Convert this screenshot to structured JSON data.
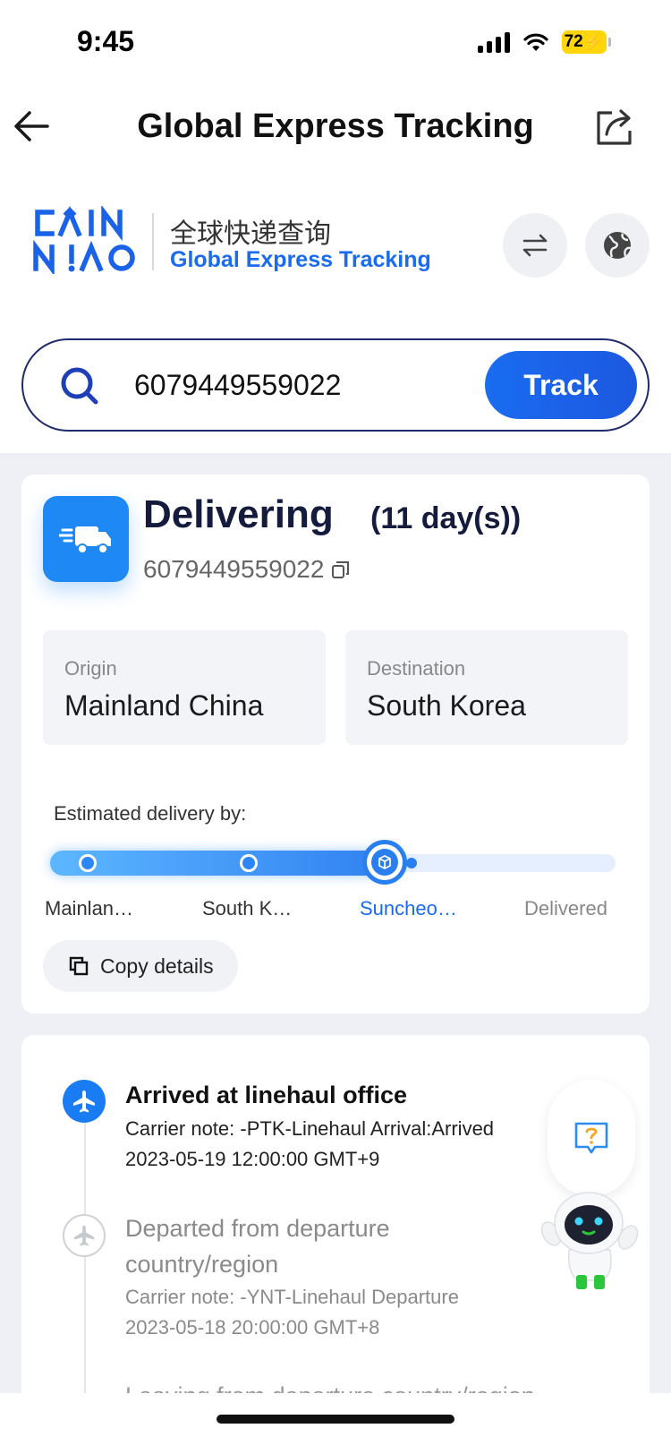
{
  "status_bar": {
    "time": "9:45",
    "battery": "72"
  },
  "header": {
    "title": "Global Express Tracking"
  },
  "brand": {
    "cn_title": "全球快递查询",
    "en_title": "Global Express Tracking"
  },
  "search": {
    "value": "6079449559022",
    "button_label": "Track"
  },
  "summary": {
    "status": "Delivering",
    "days": "(11 day(s))",
    "tracking_number": "6079449559022",
    "origin_label": "Origin",
    "origin_value": "Mainland China",
    "destination_label": "Destination",
    "destination_value": "South Korea",
    "estimate_label": "Estimated delivery by:",
    "progress_fraction": 0.62,
    "stages": [
      "Mainlan…",
      "South K…",
      "Suncheo…",
      "Delivered"
    ],
    "copy_label": "Copy details"
  },
  "timeline": [
    {
      "title": "Arrived at linehaul office",
      "note": "Carrier note: -PTK-Linehaul Arrival:Arrived",
      "time": "2023-05-19 12:00:00 GMT+9",
      "icon": "plane-icon",
      "active": true
    },
    {
      "title_line1": "Departed from departure",
      "title_line2": "country/region",
      "note": "Carrier note: -YNT-Linehaul Departure",
      "time": "2023-05-18 20:00:00 GMT+8",
      "icon": "plane-icon",
      "active": false
    }
  ],
  "timeline_cut_text": "Leaving from departure country/region",
  "colors": {
    "accent": "#1a6bf0",
    "dark_navy": "#151b3d",
    "grey_bg": "#eef0f5"
  }
}
